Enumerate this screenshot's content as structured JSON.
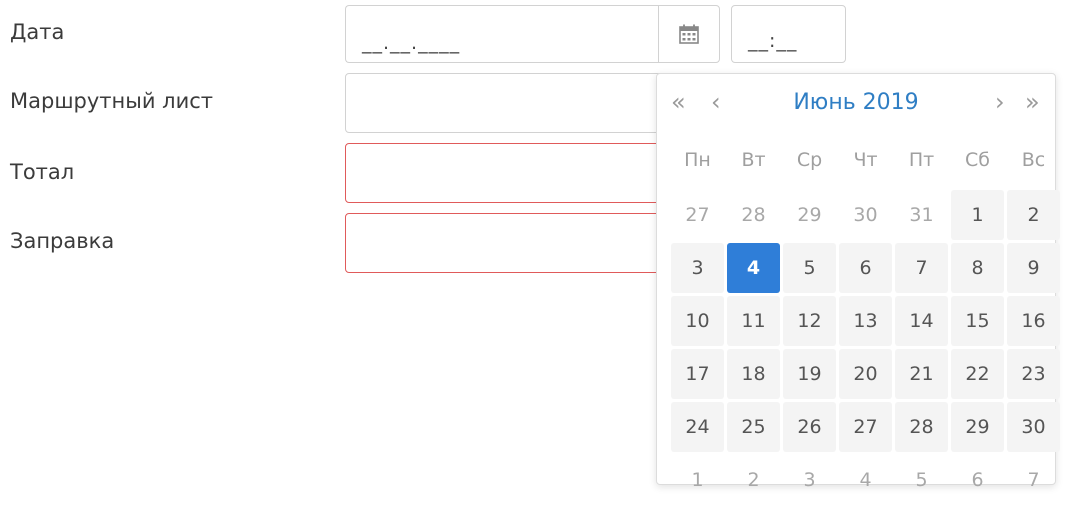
{
  "labels": {
    "date": "Дата",
    "route_sheet": "Маршрутный лист",
    "total": "Тотал",
    "refuel": "Заправка"
  },
  "date_field": {
    "value": "__.__.____"
  },
  "time_field": {
    "value": "__:__"
  },
  "calendar": {
    "title": "Июнь 2019",
    "nav": {
      "prev_year": "«",
      "prev_month": "‹",
      "next_month": "›",
      "next_year": "»"
    },
    "weekdays": [
      "Пн",
      "Вт",
      "Ср",
      "Чт",
      "Пт",
      "Сб",
      "Вс"
    ],
    "weeks": [
      [
        {
          "d": "27",
          "t": "other"
        },
        {
          "d": "28",
          "t": "other"
        },
        {
          "d": "29",
          "t": "other"
        },
        {
          "d": "30",
          "t": "other"
        },
        {
          "d": "31",
          "t": "other"
        },
        {
          "d": "1",
          "t": "cur"
        },
        {
          "d": "2",
          "t": "cur"
        }
      ],
      [
        {
          "d": "3",
          "t": "cur"
        },
        {
          "d": "4",
          "t": "selected"
        },
        {
          "d": "5",
          "t": "cur"
        },
        {
          "d": "6",
          "t": "cur"
        },
        {
          "d": "7",
          "t": "cur"
        },
        {
          "d": "8",
          "t": "cur"
        },
        {
          "d": "9",
          "t": "cur"
        }
      ],
      [
        {
          "d": "10",
          "t": "cur"
        },
        {
          "d": "11",
          "t": "cur"
        },
        {
          "d": "12",
          "t": "cur"
        },
        {
          "d": "13",
          "t": "cur"
        },
        {
          "d": "14",
          "t": "cur"
        },
        {
          "d": "15",
          "t": "cur"
        },
        {
          "d": "16",
          "t": "cur"
        }
      ],
      [
        {
          "d": "17",
          "t": "cur"
        },
        {
          "d": "18",
          "t": "cur"
        },
        {
          "d": "19",
          "t": "cur"
        },
        {
          "d": "20",
          "t": "cur"
        },
        {
          "d": "21",
          "t": "cur"
        },
        {
          "d": "22",
          "t": "cur"
        },
        {
          "d": "23",
          "t": "cur"
        }
      ],
      [
        {
          "d": "24",
          "t": "cur"
        },
        {
          "d": "25",
          "t": "cur"
        },
        {
          "d": "26",
          "t": "cur"
        },
        {
          "d": "27",
          "t": "cur"
        },
        {
          "d": "28",
          "t": "cur"
        },
        {
          "d": "29",
          "t": "cur"
        },
        {
          "d": "30",
          "t": "cur"
        }
      ],
      [
        {
          "d": "1",
          "t": "other"
        },
        {
          "d": "2",
          "t": "other"
        },
        {
          "d": "3",
          "t": "other"
        },
        {
          "d": "4",
          "t": "other"
        },
        {
          "d": "5",
          "t": "other"
        },
        {
          "d": "6",
          "t": "other"
        },
        {
          "d": "7",
          "t": "other"
        }
      ]
    ]
  },
  "icons": {
    "calendar_button": "calendar-icon"
  },
  "colors": {
    "accent": "#2f7ed8",
    "error_border": "#e05a5a",
    "title": "#2f7ec4"
  }
}
